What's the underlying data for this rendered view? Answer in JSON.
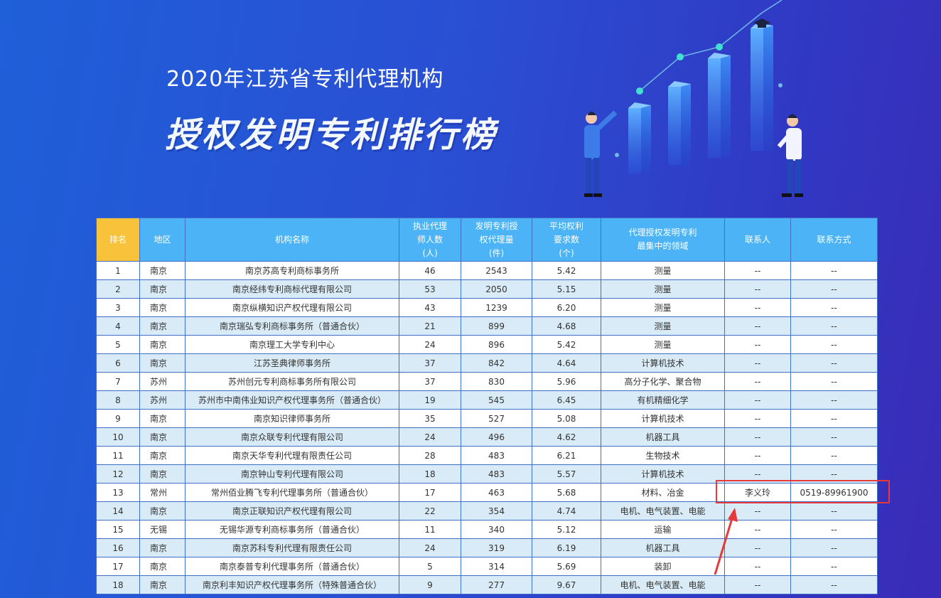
{
  "banner": {
    "subtitle": "2020年江苏省专利代理机构",
    "title": "授权发明专利排行榜"
  },
  "table": {
    "headers": {
      "rank": "排名",
      "region": "地区",
      "name": "机构名称",
      "agents": [
        "执业代理",
        "师人数",
        "(人)"
      ],
      "patents": [
        "发明专利授",
        "权代理量",
        "(件)"
      ],
      "claims": [
        "平均权利",
        "要求数",
        "(个)"
      ],
      "field": [
        "代理授权发明专利",
        "最集中的领域"
      ],
      "contact": "联系人",
      "phone": "联系方式"
    },
    "rows": [
      {
        "rank": "1",
        "region": "南京",
        "name": "南京苏高专利商标事务所",
        "agents": "46",
        "patents": "2543",
        "claims": "5.42",
        "field": "测量",
        "contact": "--",
        "phone": "--"
      },
      {
        "rank": "2",
        "region": "南京",
        "name": "南京经纬专利商标代理有限公司",
        "agents": "53",
        "patents": "2050",
        "claims": "5.15",
        "field": "测量",
        "contact": "--",
        "phone": "--"
      },
      {
        "rank": "3",
        "region": "南京",
        "name": "南京纵横知识产权代理有限公司",
        "agents": "43",
        "patents": "1239",
        "claims": "6.20",
        "field": "测量",
        "contact": "--",
        "phone": "--"
      },
      {
        "rank": "4",
        "region": "南京",
        "name": "南京瑞弘专利商标事务所（普通合伙）",
        "agents": "21",
        "patents": "899",
        "claims": "4.68",
        "field": "测量",
        "contact": "--",
        "phone": "--"
      },
      {
        "rank": "5",
        "region": "南京",
        "name": "南京理工大学专利中心",
        "agents": "24",
        "patents": "896",
        "claims": "5.42",
        "field": "测量",
        "contact": "--",
        "phone": "--"
      },
      {
        "rank": "6",
        "region": "南京",
        "name": "江苏圣典律师事务所",
        "agents": "37",
        "patents": "842",
        "claims": "4.64",
        "field": "计算机技术",
        "contact": "--",
        "phone": "--"
      },
      {
        "rank": "7",
        "region": "苏州",
        "name": "苏州创元专利商标事务所有限公司",
        "agents": "37",
        "patents": "830",
        "claims": "5.96",
        "field": "高分子化学、聚合物",
        "contact": "--",
        "phone": "--"
      },
      {
        "rank": "8",
        "region": "苏州",
        "name": "苏州市中南伟业知识产权代理事务所（普通合伙）",
        "agents": "19",
        "patents": "545",
        "claims": "6.45",
        "field": "有机精细化学",
        "contact": "--",
        "phone": "--"
      },
      {
        "rank": "9",
        "region": "南京",
        "name": "南京知识律师事务所",
        "agents": "35",
        "patents": "527",
        "claims": "5.08",
        "field": "计算机技术",
        "contact": "--",
        "phone": "--"
      },
      {
        "rank": "10",
        "region": "南京",
        "name": "南京众联专利代理有限公司",
        "agents": "24",
        "patents": "496",
        "claims": "4.62",
        "field": "机器工具",
        "contact": "--",
        "phone": "--"
      },
      {
        "rank": "11",
        "region": "南京",
        "name": "南京天华专利代理有限责任公司",
        "agents": "28",
        "patents": "483",
        "claims": "6.21",
        "field": "生物技术",
        "contact": "--",
        "phone": "--"
      },
      {
        "rank": "12",
        "region": "南京",
        "name": "南京钟山专利代理有限公司",
        "agents": "18",
        "patents": "483",
        "claims": "5.57",
        "field": "计算机技术",
        "contact": "--",
        "phone": "--"
      },
      {
        "rank": "13",
        "region": "常州",
        "name": "常州佰业腾飞专利代理事务所（普通合伙）",
        "agents": "17",
        "patents": "463",
        "claims": "5.68",
        "field": "材料、冶金",
        "contact": "李义玲",
        "phone": "0519-89961900"
      },
      {
        "rank": "14",
        "region": "南京",
        "name": "南京正联知识产权代理有限公司",
        "agents": "22",
        "patents": "354",
        "claims": "4.74",
        "field": "电机、电气装置、电能",
        "contact": "--",
        "phone": "--"
      },
      {
        "rank": "15",
        "region": "无锡",
        "name": "无锡华源专利商标事务所（普通合伙）",
        "agents": "11",
        "patents": "340",
        "claims": "5.12",
        "field": "运输",
        "contact": "--",
        "phone": "--"
      },
      {
        "rank": "16",
        "region": "南京",
        "name": "南京苏科专利代理有限责任公司",
        "agents": "24",
        "patents": "319",
        "claims": "6.19",
        "field": "机器工具",
        "contact": "--",
        "phone": "--"
      },
      {
        "rank": "17",
        "region": "南京",
        "name": "南京泰普专利代理事务所（普通合伙）",
        "agents": "5",
        "patents": "314",
        "claims": "5.69",
        "field": "装卸",
        "contact": "--",
        "phone": "--"
      },
      {
        "rank": "18",
        "region": "南京",
        "name": "南京利丰知识产权代理事务所（特殊普通合伙）",
        "agents": "9",
        "patents": "277",
        "claims": "9.67",
        "field": "电机、电气装置、电能",
        "contact": "--",
        "phone": "--"
      }
    ]
  },
  "colors": {
    "header_bg": "#4cb4f6",
    "rank_header_bg": "#f8c23a",
    "row_alt_bg": "#d9ebf6",
    "highlight": "#e63a3a"
  },
  "icons": [
    "graduation-cap-icon",
    "bar-chart-illustration",
    "highlight-arrow-icon"
  ]
}
